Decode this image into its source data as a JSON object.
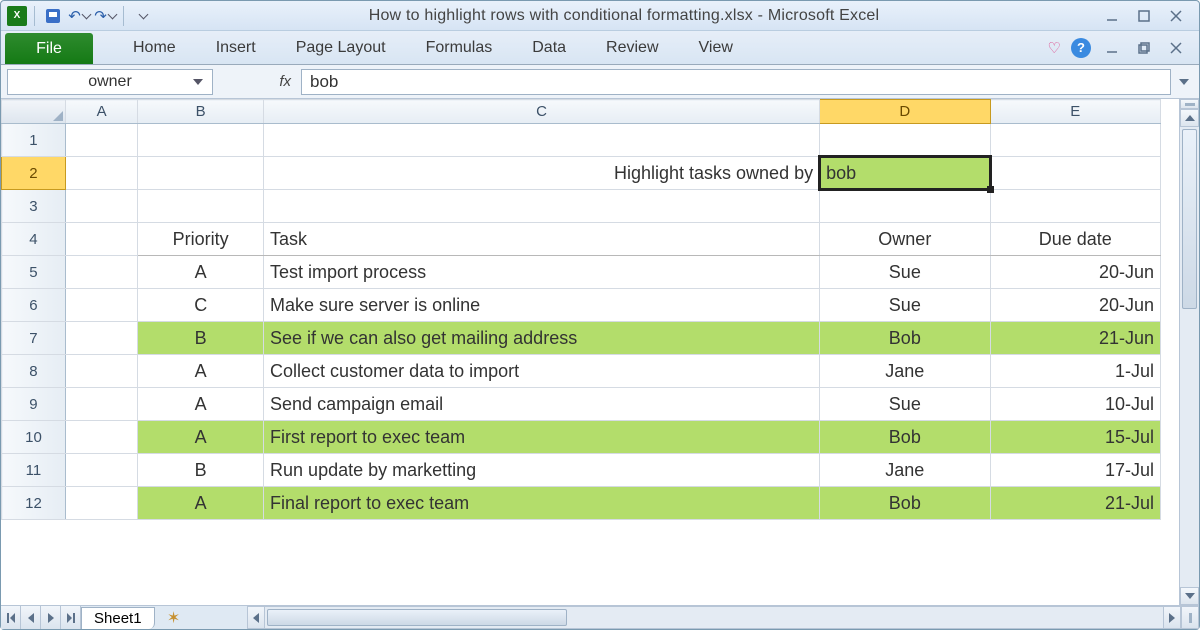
{
  "window_title": "How to highlight rows with conditional formatting.xlsx - Microsoft Excel",
  "ribbon": {
    "file": "File",
    "tabs": [
      "Home",
      "Insert",
      "Page Layout",
      "Formulas",
      "Data",
      "Review",
      "View"
    ]
  },
  "formula_bar": {
    "namebox": "owner",
    "fx_label": "fx",
    "formula": "bob"
  },
  "columns": [
    "A",
    "B",
    "C",
    "D",
    "E"
  ],
  "selected_col": "D",
  "row_numbers": [
    1,
    2,
    3,
    4,
    5,
    6,
    7,
    8,
    9,
    10,
    11,
    12
  ],
  "selected_row": 2,
  "prompt": {
    "label": "Highlight tasks owned by",
    "value": "bob"
  },
  "headers": {
    "priority": "Priority",
    "task": "Task",
    "owner": "Owner",
    "due": "Due date"
  },
  "rows": [
    {
      "priority": "A",
      "task": "Test import process",
      "owner": "Sue",
      "due": "20-Jun",
      "hl": false
    },
    {
      "priority": "C",
      "task": "Make sure server is online",
      "owner": "Sue",
      "due": "20-Jun",
      "hl": false
    },
    {
      "priority": "B",
      "task": "See if we can also get mailing address",
      "owner": "Bob",
      "due": "21-Jun",
      "hl": true
    },
    {
      "priority": "A",
      "task": "Collect customer data to import",
      "owner": "Jane",
      "due": "1-Jul",
      "hl": false
    },
    {
      "priority": "A",
      "task": "Send campaign email",
      "owner": "Sue",
      "due": "10-Jul",
      "hl": false
    },
    {
      "priority": "A",
      "task": "First report to exec team",
      "owner": "Bob",
      "due": "15-Jul",
      "hl": true
    },
    {
      "priority": "B",
      "task": "Run update by marketting",
      "owner": "Jane",
      "due": "17-Jul",
      "hl": false
    },
    {
      "priority": "A",
      "task": "Final report to exec team",
      "owner": "Bob",
      "due": "21-Jul",
      "hl": true
    }
  ],
  "sheet_tab": "Sheet1",
  "chart_data": {
    "type": "table",
    "title": "Highlight tasks owned by bob",
    "columns": [
      "Priority",
      "Task",
      "Owner",
      "Due date"
    ],
    "rows": [
      [
        "A",
        "Test import process",
        "Sue",
        "20-Jun"
      ],
      [
        "C",
        "Make sure server is online",
        "Sue",
        "20-Jun"
      ],
      [
        "B",
        "See if we can also get mailing address",
        "Bob",
        "21-Jun"
      ],
      [
        "A",
        "Collect customer data to import",
        "Jane",
        "1-Jul"
      ],
      [
        "A",
        "Send campaign email",
        "Sue",
        "10-Jul"
      ],
      [
        "A",
        "First report to exec team",
        "Bob",
        "15-Jul"
      ],
      [
        "B",
        "Run update by marketting",
        "Jane",
        "17-Jul"
      ],
      [
        "A",
        "Final report to exec team",
        "Bob",
        "21-Jul"
      ]
    ],
    "highlight_owner": "bob"
  }
}
